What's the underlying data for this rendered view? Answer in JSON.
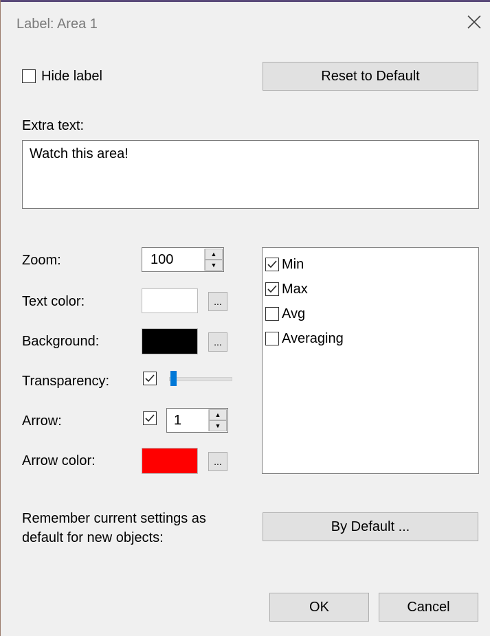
{
  "window": {
    "title": "Label: Area 1"
  },
  "hide_label": {
    "label": "Hide label",
    "checked": false
  },
  "reset_button": "Reset to Default",
  "extra_text": {
    "label": "Extra text:",
    "value": "Watch this area!"
  },
  "zoom": {
    "label": "Zoom:",
    "value": "100"
  },
  "text_color": {
    "label": "Text color:",
    "color": "#ffffff",
    "picker_label": "..."
  },
  "background": {
    "label": "Background:",
    "color": "#000000",
    "picker_label": "..."
  },
  "transparency": {
    "label": "Transparency:",
    "checked": true,
    "level": 0.05
  },
  "arrow": {
    "label": "Arrow:",
    "checked": true,
    "value": "1"
  },
  "arrow_color": {
    "label": "Arrow color:",
    "color": "#ff0000",
    "picker_label": "..."
  },
  "stats_list": [
    {
      "label": "Min",
      "checked": true
    },
    {
      "label": "Max",
      "checked": true
    },
    {
      "label": "Avg",
      "checked": false
    },
    {
      "label": "Averaging",
      "checked": false
    }
  ],
  "remember": {
    "text_line1": "Remember current settings as",
    "text_line2": "default for new objects:",
    "button": "By Default ..."
  },
  "footer": {
    "ok": "OK",
    "cancel": "Cancel"
  },
  "colors": {
    "accent": "#0078d7"
  }
}
